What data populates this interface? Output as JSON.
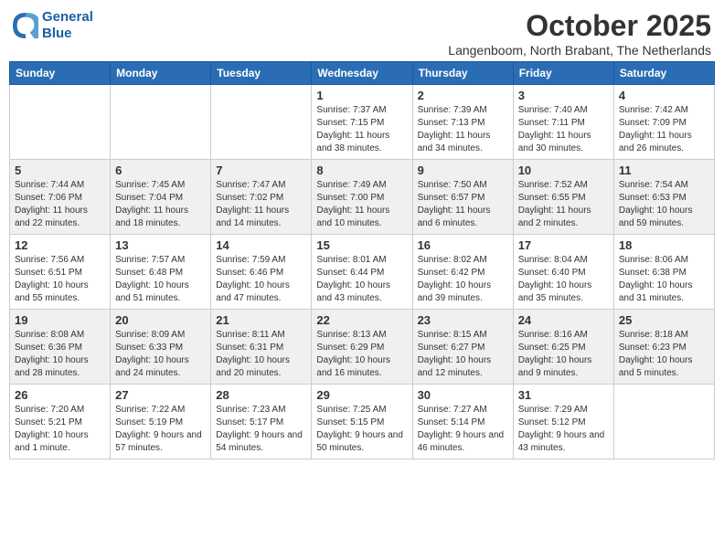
{
  "logo": {
    "line1": "General",
    "line2": "Blue"
  },
  "title": "October 2025",
  "subtitle": "Langenboom, North Brabant, The Netherlands",
  "days_of_week": [
    "Sunday",
    "Monday",
    "Tuesday",
    "Wednesday",
    "Thursday",
    "Friday",
    "Saturday"
  ],
  "weeks": [
    [
      {
        "day": "",
        "info": ""
      },
      {
        "day": "",
        "info": ""
      },
      {
        "day": "",
        "info": ""
      },
      {
        "day": "1",
        "info": "Sunrise: 7:37 AM\nSunset: 7:15 PM\nDaylight: 11 hours\nand 38 minutes."
      },
      {
        "day": "2",
        "info": "Sunrise: 7:39 AM\nSunset: 7:13 PM\nDaylight: 11 hours\nand 34 minutes."
      },
      {
        "day": "3",
        "info": "Sunrise: 7:40 AM\nSunset: 7:11 PM\nDaylight: 11 hours\nand 30 minutes."
      },
      {
        "day": "4",
        "info": "Sunrise: 7:42 AM\nSunset: 7:09 PM\nDaylight: 11 hours\nand 26 minutes."
      }
    ],
    [
      {
        "day": "5",
        "info": "Sunrise: 7:44 AM\nSunset: 7:06 PM\nDaylight: 11 hours\nand 22 minutes."
      },
      {
        "day": "6",
        "info": "Sunrise: 7:45 AM\nSunset: 7:04 PM\nDaylight: 11 hours\nand 18 minutes."
      },
      {
        "day": "7",
        "info": "Sunrise: 7:47 AM\nSunset: 7:02 PM\nDaylight: 11 hours\nand 14 minutes."
      },
      {
        "day": "8",
        "info": "Sunrise: 7:49 AM\nSunset: 7:00 PM\nDaylight: 11 hours\nand 10 minutes."
      },
      {
        "day": "9",
        "info": "Sunrise: 7:50 AM\nSunset: 6:57 PM\nDaylight: 11 hours\nand 6 minutes."
      },
      {
        "day": "10",
        "info": "Sunrise: 7:52 AM\nSunset: 6:55 PM\nDaylight: 11 hours\nand 2 minutes."
      },
      {
        "day": "11",
        "info": "Sunrise: 7:54 AM\nSunset: 6:53 PM\nDaylight: 10 hours\nand 59 minutes."
      }
    ],
    [
      {
        "day": "12",
        "info": "Sunrise: 7:56 AM\nSunset: 6:51 PM\nDaylight: 10 hours\nand 55 minutes."
      },
      {
        "day": "13",
        "info": "Sunrise: 7:57 AM\nSunset: 6:48 PM\nDaylight: 10 hours\nand 51 minutes."
      },
      {
        "day": "14",
        "info": "Sunrise: 7:59 AM\nSunset: 6:46 PM\nDaylight: 10 hours\nand 47 minutes."
      },
      {
        "day": "15",
        "info": "Sunrise: 8:01 AM\nSunset: 6:44 PM\nDaylight: 10 hours\nand 43 minutes."
      },
      {
        "day": "16",
        "info": "Sunrise: 8:02 AM\nSunset: 6:42 PM\nDaylight: 10 hours\nand 39 minutes."
      },
      {
        "day": "17",
        "info": "Sunrise: 8:04 AM\nSunset: 6:40 PM\nDaylight: 10 hours\nand 35 minutes."
      },
      {
        "day": "18",
        "info": "Sunrise: 8:06 AM\nSunset: 6:38 PM\nDaylight: 10 hours\nand 31 minutes."
      }
    ],
    [
      {
        "day": "19",
        "info": "Sunrise: 8:08 AM\nSunset: 6:36 PM\nDaylight: 10 hours\nand 28 minutes."
      },
      {
        "day": "20",
        "info": "Sunrise: 8:09 AM\nSunset: 6:33 PM\nDaylight: 10 hours\nand 24 minutes."
      },
      {
        "day": "21",
        "info": "Sunrise: 8:11 AM\nSunset: 6:31 PM\nDaylight: 10 hours\nand 20 minutes."
      },
      {
        "day": "22",
        "info": "Sunrise: 8:13 AM\nSunset: 6:29 PM\nDaylight: 10 hours\nand 16 minutes."
      },
      {
        "day": "23",
        "info": "Sunrise: 8:15 AM\nSunset: 6:27 PM\nDaylight: 10 hours\nand 12 minutes."
      },
      {
        "day": "24",
        "info": "Sunrise: 8:16 AM\nSunset: 6:25 PM\nDaylight: 10 hours\nand 9 minutes."
      },
      {
        "day": "25",
        "info": "Sunrise: 8:18 AM\nSunset: 6:23 PM\nDaylight: 10 hours\nand 5 minutes."
      }
    ],
    [
      {
        "day": "26",
        "info": "Sunrise: 7:20 AM\nSunset: 5:21 PM\nDaylight: 10 hours\nand 1 minute."
      },
      {
        "day": "27",
        "info": "Sunrise: 7:22 AM\nSunset: 5:19 PM\nDaylight: 9 hours\nand 57 minutes."
      },
      {
        "day": "28",
        "info": "Sunrise: 7:23 AM\nSunset: 5:17 PM\nDaylight: 9 hours\nand 54 minutes."
      },
      {
        "day": "29",
        "info": "Sunrise: 7:25 AM\nSunset: 5:15 PM\nDaylight: 9 hours\nand 50 minutes."
      },
      {
        "day": "30",
        "info": "Sunrise: 7:27 AM\nSunset: 5:14 PM\nDaylight: 9 hours\nand 46 minutes."
      },
      {
        "day": "31",
        "info": "Sunrise: 7:29 AM\nSunset: 5:12 PM\nDaylight: 9 hours\nand 43 minutes."
      },
      {
        "day": "",
        "info": ""
      }
    ]
  ]
}
